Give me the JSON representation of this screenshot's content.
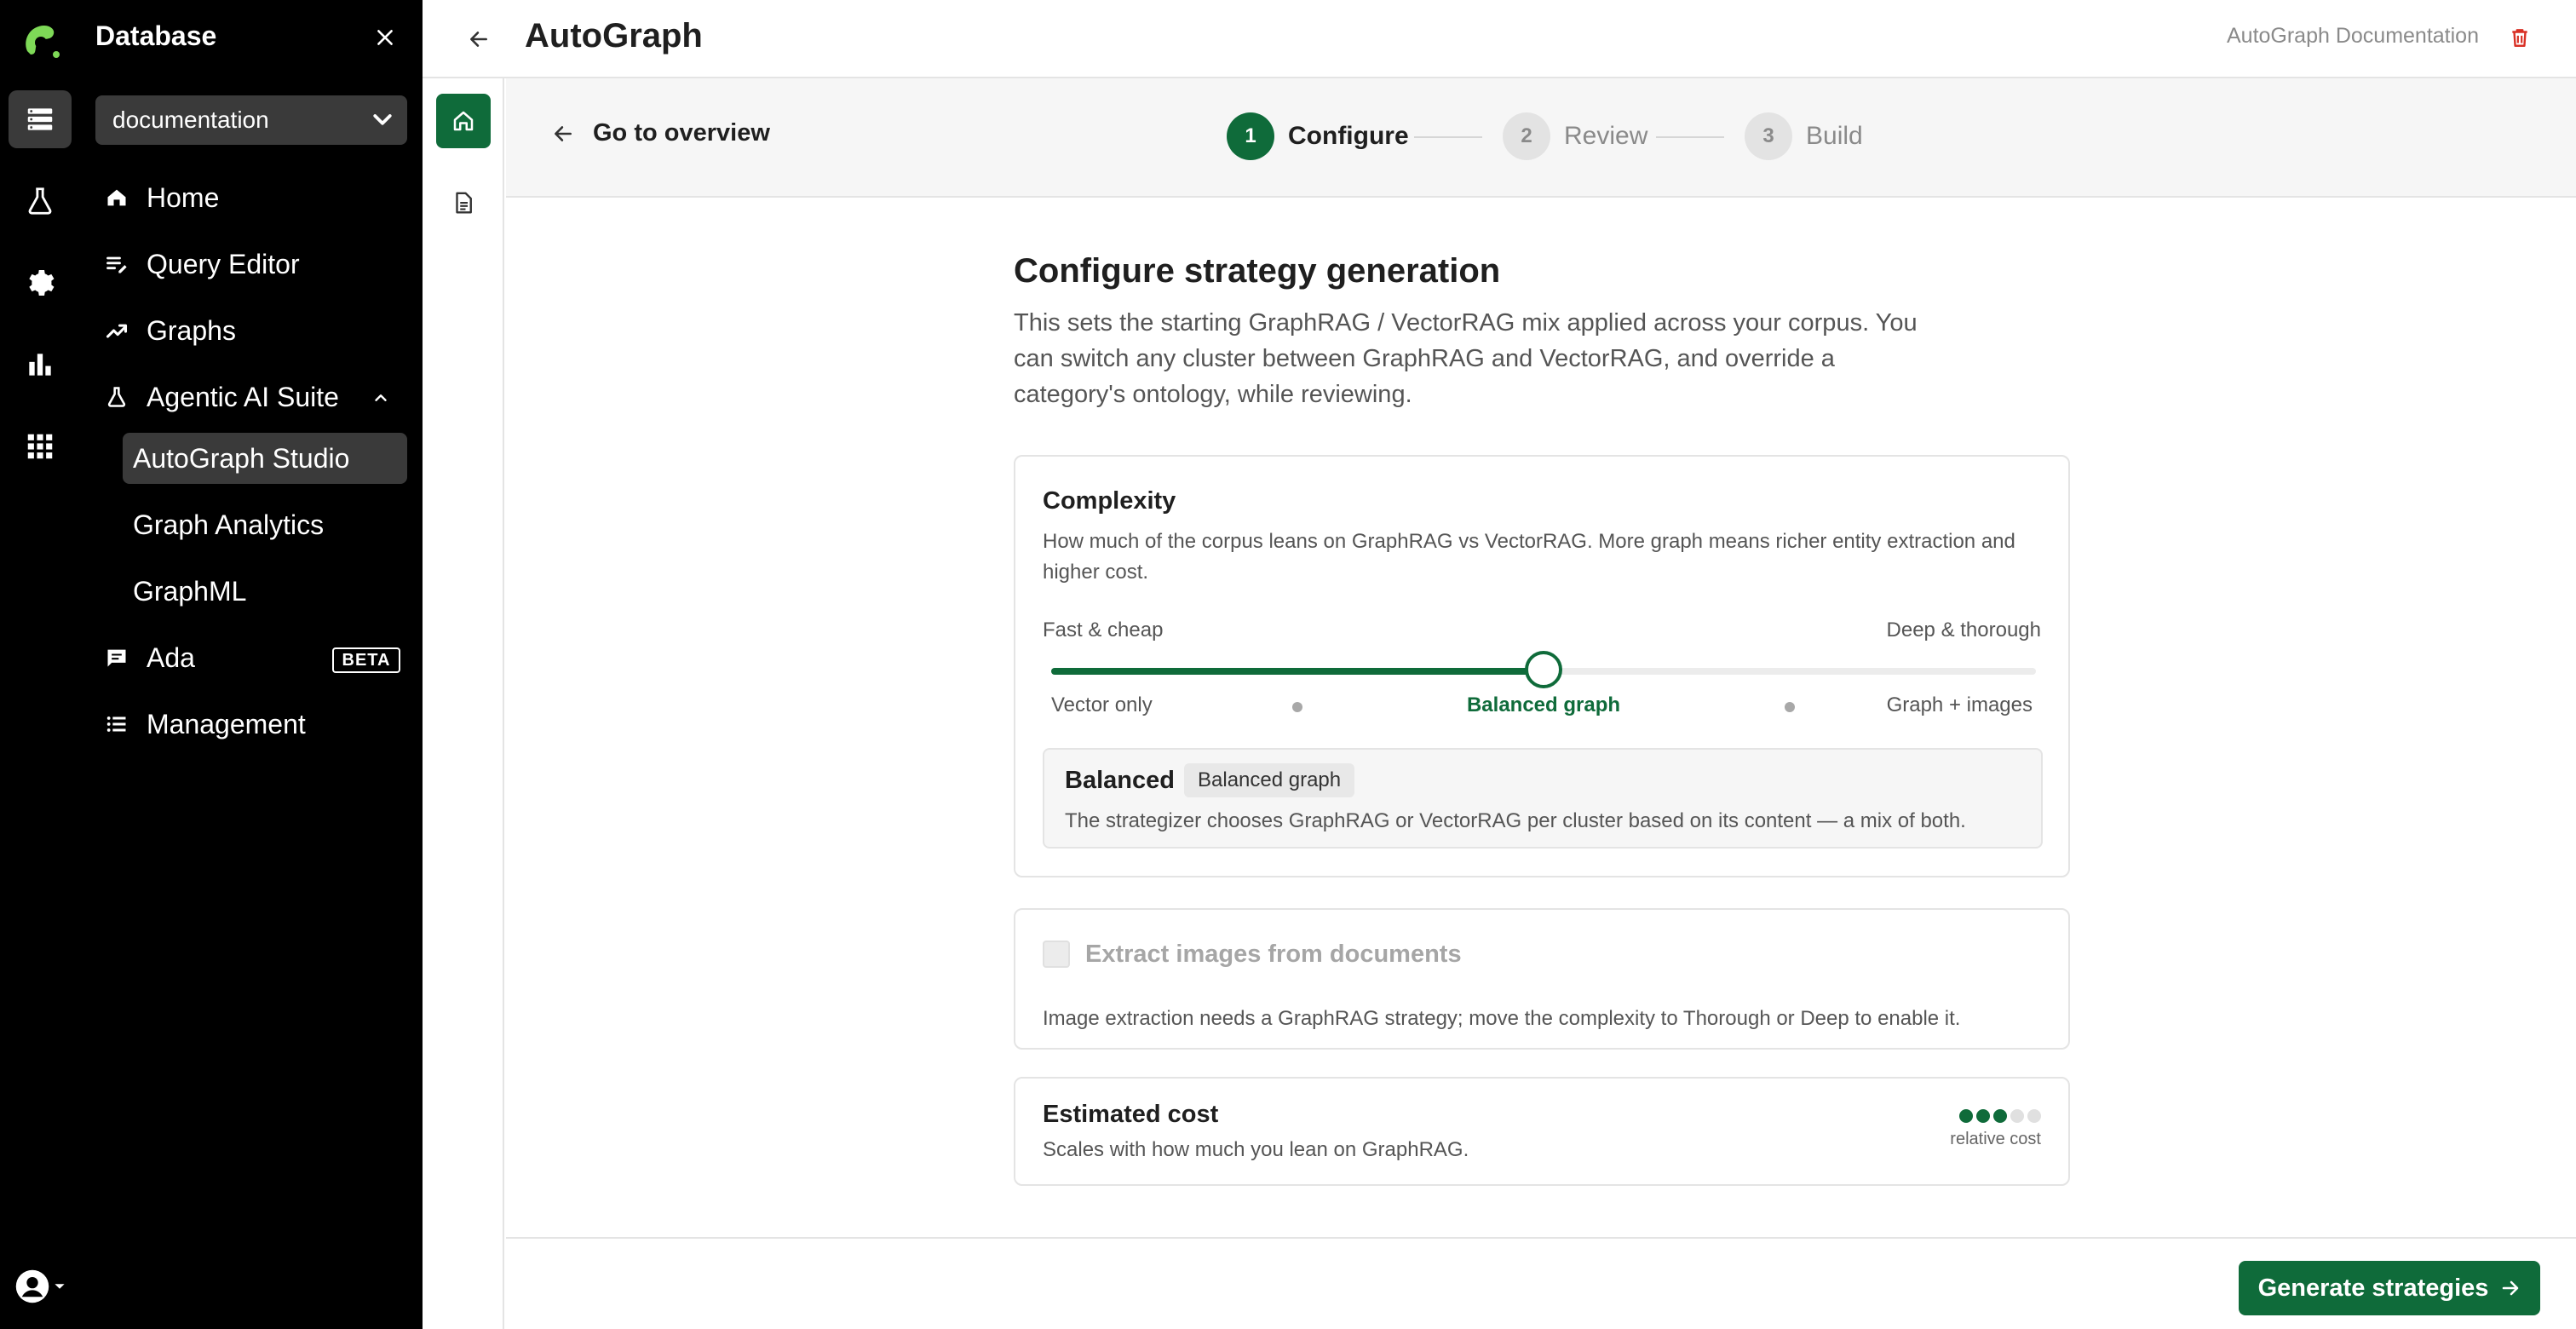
{
  "sidebar": {
    "title": "Database",
    "database": "documentation",
    "items": [
      {
        "label": "Home",
        "icon": "home-icon"
      },
      {
        "label": "Query Editor",
        "icon": "query-editor-icon"
      },
      {
        "label": "Graphs",
        "icon": "trending-icon"
      },
      {
        "label": "Agentic AI Suite",
        "icon": "flask-icon"
      },
      {
        "label": "Ada",
        "icon": "chat-icon"
      },
      {
        "label": "Management",
        "icon": "list-icon"
      }
    ],
    "sub_items": [
      {
        "label": "AutoGraph Studio",
        "active": true
      },
      {
        "label": "Graph Analytics"
      },
      {
        "label": "GraphML"
      }
    ],
    "beta_badge": "BETA"
  },
  "rail": {
    "icons": [
      "logo-icon",
      "database-icon",
      "flask-icon",
      "gear-icon",
      "bar-chart-icon",
      "apps-grid-icon",
      "user-avatar-icon"
    ]
  },
  "header": {
    "title": "AutoGraph",
    "doc_link": "AutoGraph Documentation"
  },
  "stepper": {
    "back_label": "Go to overview",
    "steps": [
      {
        "num": "1",
        "label": "Configure",
        "active": true
      },
      {
        "num": "2",
        "label": "Review"
      },
      {
        "num": "3",
        "label": "Build"
      }
    ]
  },
  "main": {
    "heading": "Configure strategy generation",
    "intro": "This sets the starting GraphRAG / VectorRAG mix applied across your corpus. You can switch any cluster between GraphRAG and VectorRAG, and override a category's ontology, while reviewing.",
    "complexity": {
      "title": "Complexity",
      "description": "How much of the corpus leans on GraphRAG vs VectorRAG. More graph means richer entity extraction and higher cost.",
      "min_label": "Fast & cheap",
      "max_label": "Deep & thorough",
      "value_fraction": 0.5,
      "ticks": [
        "Vector only",
        "Balanced graph",
        "Graph + images"
      ],
      "selected_tick": "Balanced graph",
      "summary_title": "Balanced",
      "summary_chip": "Balanced graph",
      "summary_desc": "The strategizer chooses GraphRAG or VectorRAG per cluster based on its content — a mix of both."
    },
    "images": {
      "label": "Extract images from documents",
      "checked": false,
      "disabled": true,
      "note": "Image extraction needs a GraphRAG strategy; move the complexity to Thorough or Deep to enable it."
    },
    "cost": {
      "title": "Estimated cost",
      "description": "Scales with how much you lean on GraphRAG.",
      "level": 3,
      "max_level": 5,
      "level_label": "relative cost"
    }
  },
  "footer": {
    "generate_label": "Generate strategies"
  },
  "colors": {
    "accent": "#0f6b3a",
    "sidebar_bg": "#000000",
    "danger": "#d93025"
  }
}
